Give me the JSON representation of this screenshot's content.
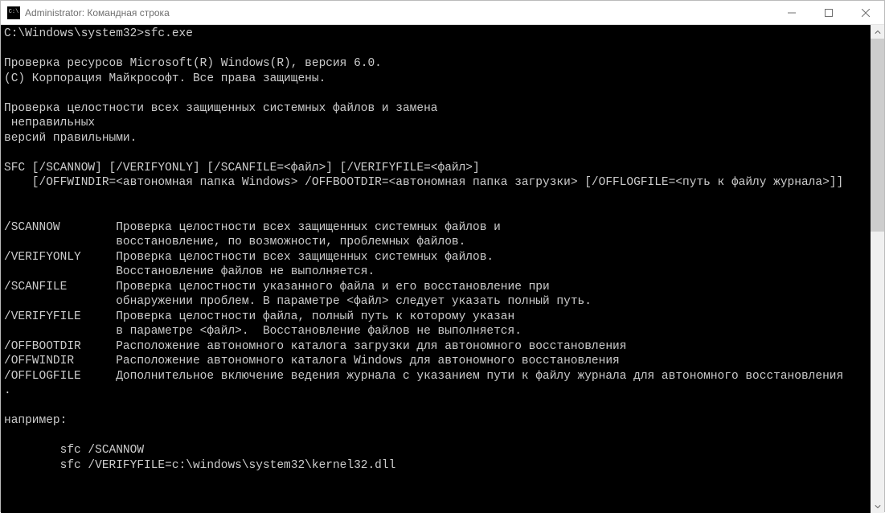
{
  "window": {
    "title": "Administrator: Командная строка"
  },
  "terminal": {
    "lines": [
      "C:\\Windows\\system32>sfc.exe",
      "",
      "Проверка ресурсов Microsoft(R) Windows(R), версия 6.0.",
      "(C) Корпорация Майкрософт. Все права защищены.",
      "",
      "Проверка целостности всех защищенных системных файлов и замена",
      " неправильных",
      "версий правильными.",
      "",
      "SFC [/SCANNOW] [/VERIFYONLY] [/SCANFILE=<файл>] [/VERIFYFILE=<файл>]",
      "    [/OFFWINDIR=<автономная папка Windows> /OFFBOOTDIR=<автономная папка загрузки> [/OFFLOGFILE=<путь к файлу журнала>]]",
      "",
      "",
      "/SCANNOW        Проверка целостности всех защищенных системных файлов и",
      "                восстановление, по возможности, проблемных файлов.",
      "/VERIFYONLY     Проверка целостности всех защищенных системных файлов.",
      "                Восстановление файлов не выполняется.",
      "/SCANFILE       Проверка целостности указанного файла и его восстановление при",
      "                обнаружении проблем. В параметре <файл> следует указать полный путь.",
      "/VERIFYFILE     Проверка целостности файла, полный путь к которому указан",
      "                в параметре <файл>.  Восстановление файлов не выполняется.",
      "/OFFBOOTDIR     Расположение автономного каталога загрузки для автономного восстановления",
      "/OFFWINDIR      Расположение автономного каталога Windows для автономного восстановления",
      "/OFFLOGFILE     Дополнительное включение ведения журнала с указанием пути к файлу журнала для автономного восстановления",
      ".",
      "",
      "например:",
      "",
      "        sfc /SCANNOW",
      "        sfc /VERIFYFILE=c:\\windows\\system32\\kernel32.dll"
    ]
  }
}
